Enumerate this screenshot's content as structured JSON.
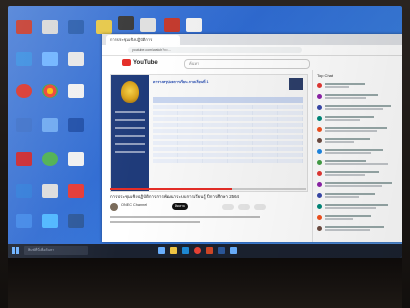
{
  "browser": {
    "tab_title": "การประชุมเชิงปฏิบัติการ",
    "url": "youtube.com/watch?v=...",
    "youtube_logo_text": "YouTube",
    "search_placeholder": "ค้นหา"
  },
  "sheet": {
    "title": "ตารางสรุปผลการเรียน ภาคเรียนที่ 1"
  },
  "video": {
    "title": "การประชุมเชิงปฏิบัติการการพัฒนาระบบการเรียนรู้ ปีการศึกษา 2564",
    "channel": "ONEC Channel",
    "subscribe_label": "ติดตาม",
    "progress_fraction": 0.62
  },
  "chat": {
    "header": "Top Chat"
  },
  "taskbar": {
    "search_placeholder": "พิมพ์ที่นี่เพื่อค้นหา",
    "clock_time": "",
    "clock_date": ""
  },
  "colors": {
    "youtube_red": "#e52d27",
    "desktop_blue": "#2f6bd2",
    "sheet_sidebar": "#1f3b7a",
    "taskbar": "#1b2230"
  }
}
